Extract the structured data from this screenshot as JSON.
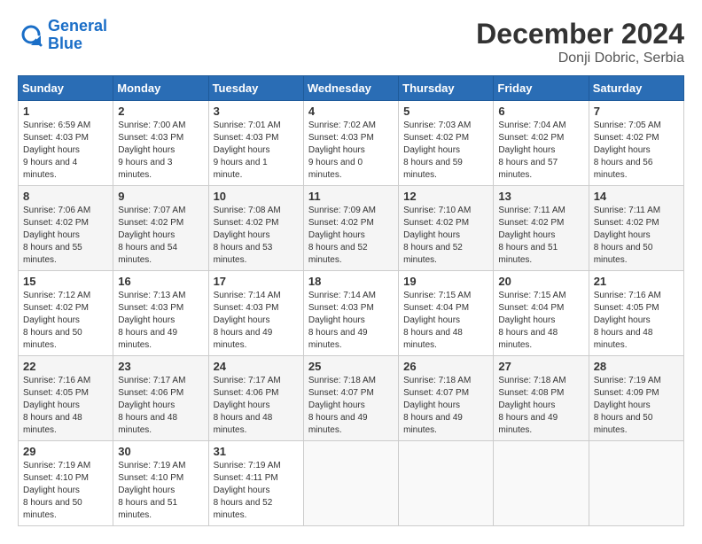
{
  "header": {
    "logo_line1": "General",
    "logo_line2": "Blue",
    "month_title": "December 2024",
    "location": "Donji Dobric, Serbia"
  },
  "days_of_week": [
    "Sunday",
    "Monday",
    "Tuesday",
    "Wednesday",
    "Thursday",
    "Friday",
    "Saturday"
  ],
  "weeks": [
    [
      {
        "day": "1",
        "sunrise": "6:59 AM",
        "sunset": "4:03 PM",
        "daylight": "9 hours and 4 minutes."
      },
      {
        "day": "2",
        "sunrise": "7:00 AM",
        "sunset": "4:03 PM",
        "daylight": "9 hours and 3 minutes."
      },
      {
        "day": "3",
        "sunrise": "7:01 AM",
        "sunset": "4:03 PM",
        "daylight": "9 hours and 1 minute."
      },
      {
        "day": "4",
        "sunrise": "7:02 AM",
        "sunset": "4:03 PM",
        "daylight": "9 hours and 0 minutes."
      },
      {
        "day": "5",
        "sunrise": "7:03 AM",
        "sunset": "4:02 PM",
        "daylight": "8 hours and 59 minutes."
      },
      {
        "day": "6",
        "sunrise": "7:04 AM",
        "sunset": "4:02 PM",
        "daylight": "8 hours and 57 minutes."
      },
      {
        "day": "7",
        "sunrise": "7:05 AM",
        "sunset": "4:02 PM",
        "daylight": "8 hours and 56 minutes."
      }
    ],
    [
      {
        "day": "8",
        "sunrise": "7:06 AM",
        "sunset": "4:02 PM",
        "daylight": "8 hours and 55 minutes."
      },
      {
        "day": "9",
        "sunrise": "7:07 AM",
        "sunset": "4:02 PM",
        "daylight": "8 hours and 54 minutes."
      },
      {
        "day": "10",
        "sunrise": "7:08 AM",
        "sunset": "4:02 PM",
        "daylight": "8 hours and 53 minutes."
      },
      {
        "day": "11",
        "sunrise": "7:09 AM",
        "sunset": "4:02 PM",
        "daylight": "8 hours and 52 minutes."
      },
      {
        "day": "12",
        "sunrise": "7:10 AM",
        "sunset": "4:02 PM",
        "daylight": "8 hours and 52 minutes."
      },
      {
        "day": "13",
        "sunrise": "7:11 AM",
        "sunset": "4:02 PM",
        "daylight": "8 hours and 51 minutes."
      },
      {
        "day": "14",
        "sunrise": "7:11 AM",
        "sunset": "4:02 PM",
        "daylight": "8 hours and 50 minutes."
      }
    ],
    [
      {
        "day": "15",
        "sunrise": "7:12 AM",
        "sunset": "4:02 PM",
        "daylight": "8 hours and 50 minutes."
      },
      {
        "day": "16",
        "sunrise": "7:13 AM",
        "sunset": "4:03 PM",
        "daylight": "8 hours and 49 minutes."
      },
      {
        "day": "17",
        "sunrise": "7:14 AM",
        "sunset": "4:03 PM",
        "daylight": "8 hours and 49 minutes."
      },
      {
        "day": "18",
        "sunrise": "7:14 AM",
        "sunset": "4:03 PM",
        "daylight": "8 hours and 49 minutes."
      },
      {
        "day": "19",
        "sunrise": "7:15 AM",
        "sunset": "4:04 PM",
        "daylight": "8 hours and 48 minutes."
      },
      {
        "day": "20",
        "sunrise": "7:15 AM",
        "sunset": "4:04 PM",
        "daylight": "8 hours and 48 minutes."
      },
      {
        "day": "21",
        "sunrise": "7:16 AM",
        "sunset": "4:05 PM",
        "daylight": "8 hours and 48 minutes."
      }
    ],
    [
      {
        "day": "22",
        "sunrise": "7:16 AM",
        "sunset": "4:05 PM",
        "daylight": "8 hours and 48 minutes."
      },
      {
        "day": "23",
        "sunrise": "7:17 AM",
        "sunset": "4:06 PM",
        "daylight": "8 hours and 48 minutes."
      },
      {
        "day": "24",
        "sunrise": "7:17 AM",
        "sunset": "4:06 PM",
        "daylight": "8 hours and 48 minutes."
      },
      {
        "day": "25",
        "sunrise": "7:18 AM",
        "sunset": "4:07 PM",
        "daylight": "8 hours and 49 minutes."
      },
      {
        "day": "26",
        "sunrise": "7:18 AM",
        "sunset": "4:07 PM",
        "daylight": "8 hours and 49 minutes."
      },
      {
        "day": "27",
        "sunrise": "7:18 AM",
        "sunset": "4:08 PM",
        "daylight": "8 hours and 49 minutes."
      },
      {
        "day": "28",
        "sunrise": "7:19 AM",
        "sunset": "4:09 PM",
        "daylight": "8 hours and 50 minutes."
      }
    ],
    [
      {
        "day": "29",
        "sunrise": "7:19 AM",
        "sunset": "4:10 PM",
        "daylight": "8 hours and 50 minutes."
      },
      {
        "day": "30",
        "sunrise": "7:19 AM",
        "sunset": "4:10 PM",
        "daylight": "8 hours and 51 minutes."
      },
      {
        "day": "31",
        "sunrise": "7:19 AM",
        "sunset": "4:11 PM",
        "daylight": "8 hours and 52 minutes."
      },
      null,
      null,
      null,
      null
    ]
  ]
}
